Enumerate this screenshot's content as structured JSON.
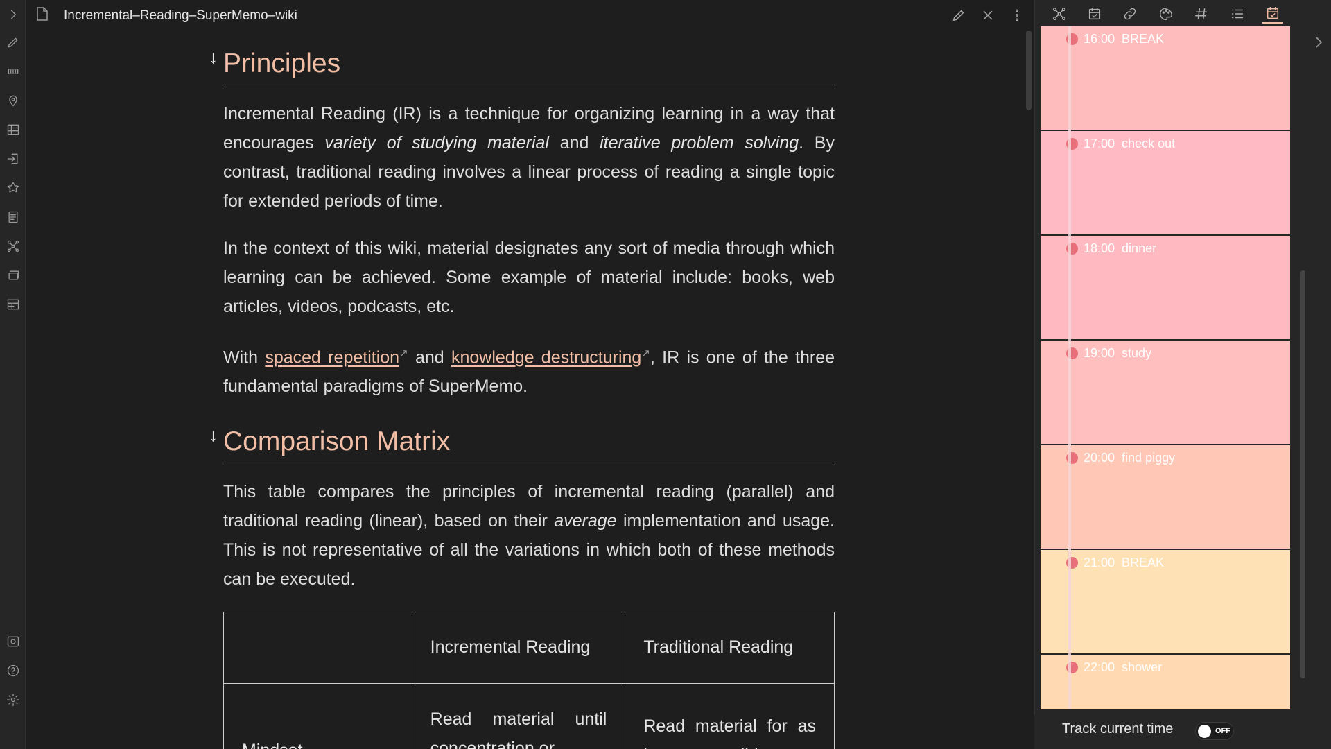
{
  "tab": {
    "title": "Incremental–Reading–SuperMemo–wiki"
  },
  "ribbon": {
    "top_icons": [
      "expand-sidebar-icon",
      "pencil-icon",
      "bookmark-icon",
      "map-pin-icon",
      "table-icon",
      "import-icon",
      "puzzle-icon",
      "note-list-icon",
      "graph-icon",
      "flashcards-icon",
      "database-icon"
    ],
    "bottom_icons": [
      "vault-icon",
      "help-icon",
      "settings-icon"
    ]
  },
  "document": {
    "sections": [
      {
        "heading": "Principles",
        "fold_glyph": "↓"
      },
      {
        "heading": "Comparison Matrix",
        "fold_glyph": "↓"
      }
    ],
    "p1": {
      "a": "Incremental Reading (IR) is a technique for organizing learning in a way that encourages ",
      "em1": "variety of studying material",
      "b": " and ",
      "em2": "iterative problem solving",
      "c": ". By contrast, traditional reading involves a linear process of reading a single topic for extended periods of time."
    },
    "p2": "In the context of this wiki, material designates any sort of media through which learning can be achieved. Some example of material include: books, web articles, videos, podcasts, etc.",
    "p3": {
      "a": "With ",
      "link1": "spaced repetition",
      "b": " and ",
      "link2": "knowledge destructuring",
      "c": ", IR is one of the three fundamental paradigms of SuperMemo."
    },
    "p4": {
      "a": "This table compares the principles of incremental reading (parallel) and traditional reading (linear), based on their ",
      "em": "average",
      "b": " implementation and usage. This is not representative of all the variations in which both of these methods can be executed."
    },
    "table": {
      "headers": [
        "",
        "Incremental Reading",
        "Traditional Reading"
      ],
      "rows": [
        [
          "Mindset",
          "Read material until concentration or",
          "Read material for as long as possible"
        ]
      ]
    }
  },
  "right_panel": {
    "tabs": [
      "graph-icon",
      "calendar-icon",
      "link-icon",
      "palette-icon",
      "tag-icon",
      "outline-icon",
      "day-planner-icon"
    ],
    "active_tab": "day-planner-icon",
    "timeline": [
      {
        "time": "16:00",
        "event": "BREAK",
        "color": "#ffbcbc"
      },
      {
        "time": "17:00",
        "event": "check out",
        "color": "#ffbac3"
      },
      {
        "time": "18:00",
        "event": "dinner",
        "color": "#ffbac1"
      },
      {
        "time": "19:00",
        "event": "study",
        "color": "#ffbfbe"
      },
      {
        "time": "20:00",
        "event": "find piggy",
        "color": "#ffc8b6"
      },
      {
        "time": "21:00",
        "event": "BREAK",
        "color": "#ffe1b6"
      },
      {
        "time": "22:00",
        "event": "shower",
        "color": "#ffd9b2"
      }
    ],
    "track": {
      "label": "Track current time",
      "toggle_text": "OFF",
      "enabled": false
    }
  }
}
